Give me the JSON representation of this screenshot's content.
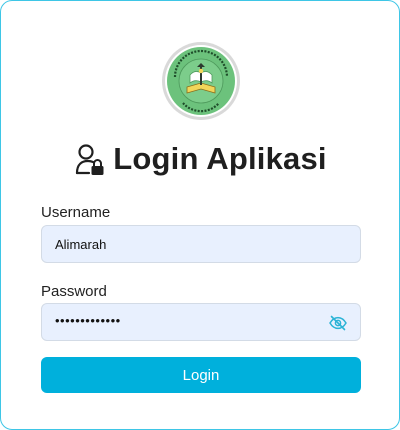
{
  "header": {
    "title": "Login Aplikasi",
    "logo_alt": "Madrasah Aliyah Al Ma'arif Gayuhmati"
  },
  "form": {
    "username_label": "Username",
    "username_value": "Alimarah",
    "password_label": "Password",
    "password_value": "•••••••••••••",
    "login_label": "Login"
  },
  "colors": {
    "accent": "#00b0dc",
    "field_bg": "#e8f0fe",
    "border": "#3ec6e6",
    "logo_green": "#6cc27c"
  },
  "icons": {
    "title_icon": "user-lock-icon",
    "password_toggle": "eye-slash-icon"
  }
}
